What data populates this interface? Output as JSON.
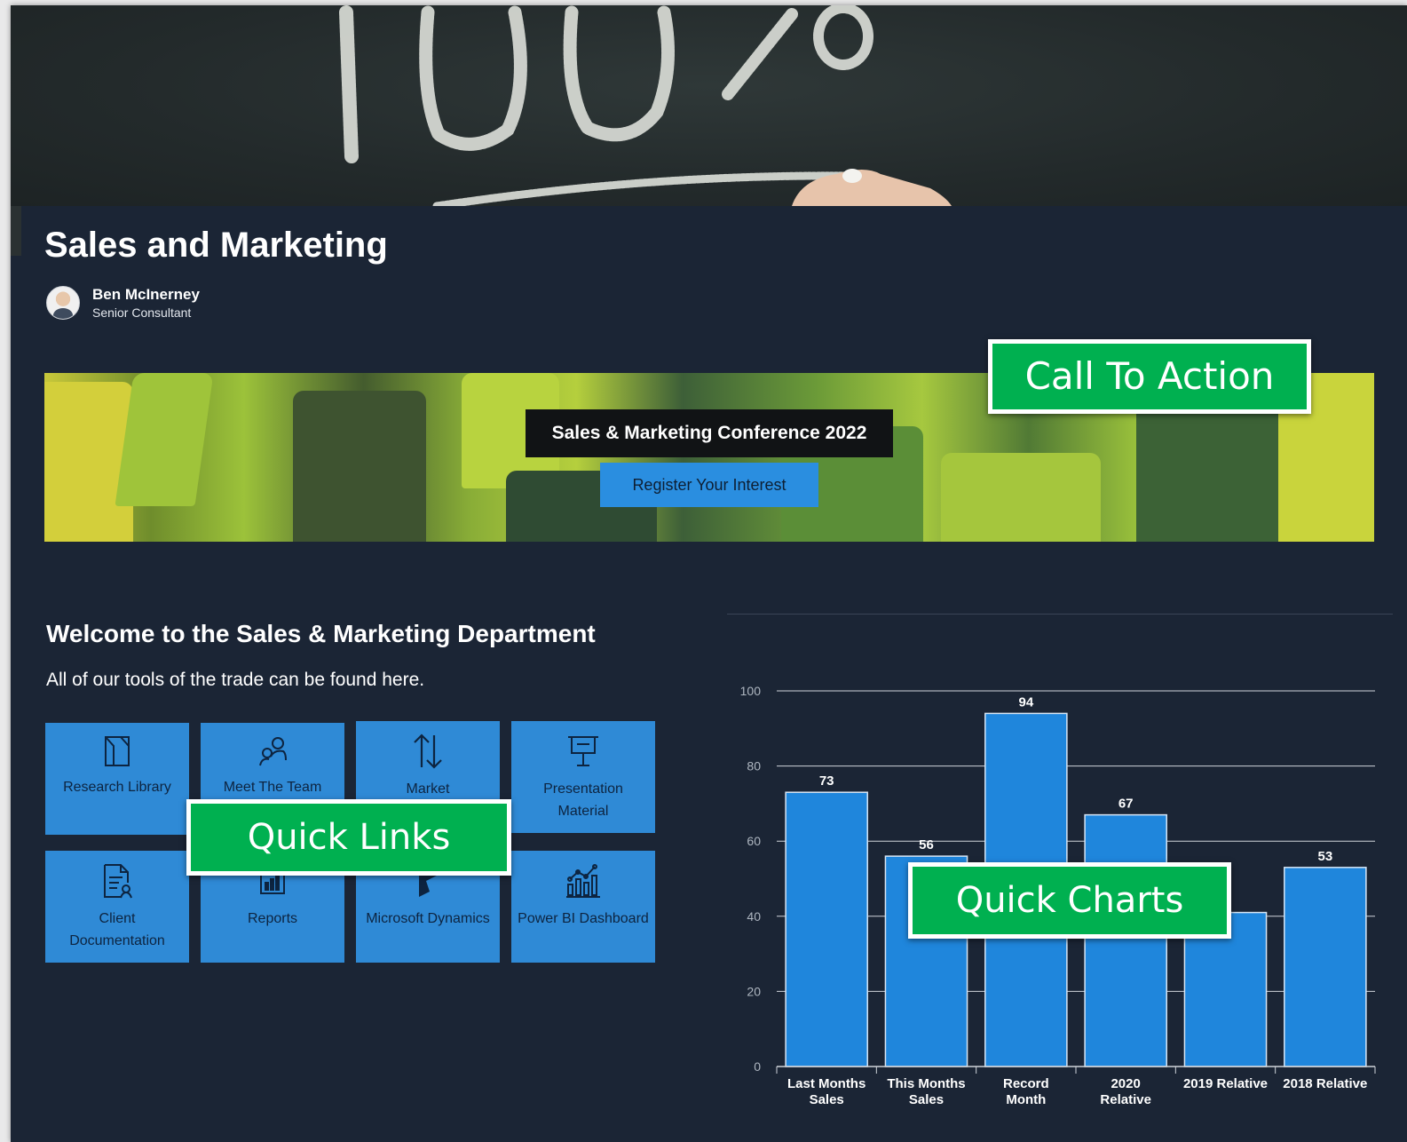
{
  "site": {
    "title": "Sales and Marketing"
  },
  "author": {
    "name": "Ben McInerney",
    "role": "Senior Consultant"
  },
  "banner": {
    "title": "Sales & Marketing Conference 2022",
    "button_label": "Register Your Interest"
  },
  "callouts": {
    "call_to_action": "Call To Action",
    "quick_links": "Quick Links",
    "quick_charts": "Quick Charts"
  },
  "welcome": {
    "title": "Welcome to the Sales & Marketing Department",
    "subtitle": "All of our tools of the trade can be found here."
  },
  "quick_links": [
    {
      "label": "Research Library",
      "icon": "library-icon"
    },
    {
      "label": "Meet The Team",
      "icon": "people-icon"
    },
    {
      "label": "Market",
      "icon": "up-down-arrows-icon"
    },
    {
      "label": "Presentation Material",
      "icon": "presentation-board-icon"
    },
    {
      "label": "Client Documentation",
      "icon": "document-person-icon"
    },
    {
      "label": "Reports",
      "icon": "bar-report-icon"
    },
    {
      "label": "Microsoft Dynamics",
      "icon": "dynamics-icon"
    },
    {
      "label": "Power BI Dashboard",
      "icon": "analytics-chart-icon"
    }
  ],
  "colors": {
    "page_bg": "#1b2535",
    "tile_bg": "#2f8ad6",
    "bar": "#1f86dc",
    "callout": "#00b050",
    "button": "#2a8ee0"
  },
  "chart_data": {
    "type": "bar",
    "categories": [
      [
        "Last Months",
        "Sales"
      ],
      [
        "This Months",
        "Sales"
      ],
      [
        "Record",
        "Month"
      ],
      [
        "2020",
        "Relative"
      ],
      [
        "2019 Relative"
      ],
      [
        "2018 Relative"
      ]
    ],
    "values": [
      73,
      56,
      94,
      67,
      41,
      53
    ],
    "data_labels": [
      "73",
      "56",
      "94",
      "67",
      "",
      "53"
    ],
    "ylim": [
      0,
      100
    ],
    "yticks": [
      0,
      20,
      40,
      60,
      80,
      100
    ],
    "grid": true,
    "title": "",
    "xlabel": "",
    "ylabel": ""
  }
}
